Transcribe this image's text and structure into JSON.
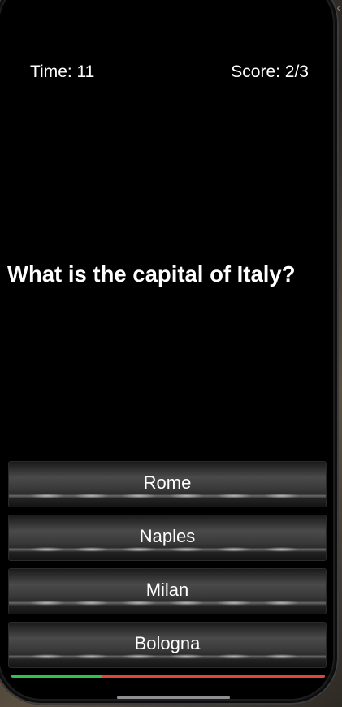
{
  "hud": {
    "time_text": "Time: 11",
    "score_text": "Score: 2/3"
  },
  "question": {
    "text": "What is the capital of Italy?"
  },
  "answers": [
    {
      "label": "Rome"
    },
    {
      "label": "Naples"
    },
    {
      "label": "Milan"
    },
    {
      "label": "Bologna"
    }
  ],
  "progress": {
    "fraction": 0.29,
    "filled_color": "#31c14f",
    "remaining_color": "#e0453a"
  },
  "icons": {
    "corner": "chevron-left-icon"
  }
}
